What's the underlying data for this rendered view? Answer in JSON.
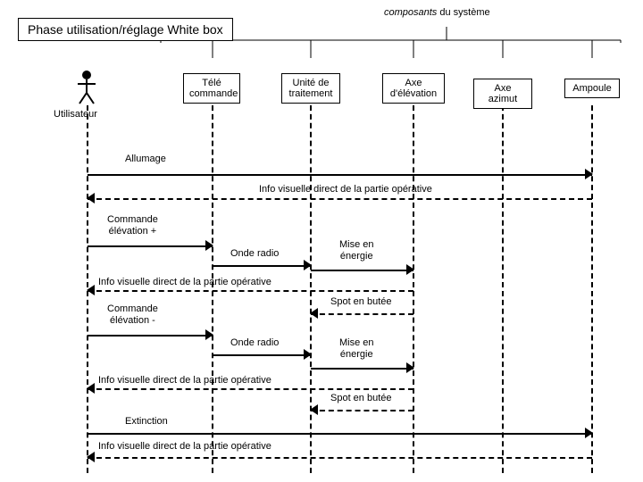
{
  "title": "Phase utilisation/réglage White box",
  "components_label_italic": "composants",
  "components_label_rest": " du système",
  "actor_label": "Utilisateur",
  "lifelines": {
    "tele": "Télé\ncommande",
    "unit": "Unité de\ntraitement",
    "elev": "Axe\nd'élévation",
    "azim": "Axe azimut",
    "amp": "Ampoule"
  },
  "messages": {
    "allumage": "Allumage",
    "info_visuelle_direct": "Info visuelle direct de la partie opérative",
    "commande_elev_plus": "Commande\nélévation +",
    "onde_radio": "Onde radio",
    "mise_en_energie": "Mise en\nénergie",
    "spot_butee": "Spot en butée",
    "commande_elev_moins": "Commande\nélévation -",
    "extinction": "Extinction"
  }
}
